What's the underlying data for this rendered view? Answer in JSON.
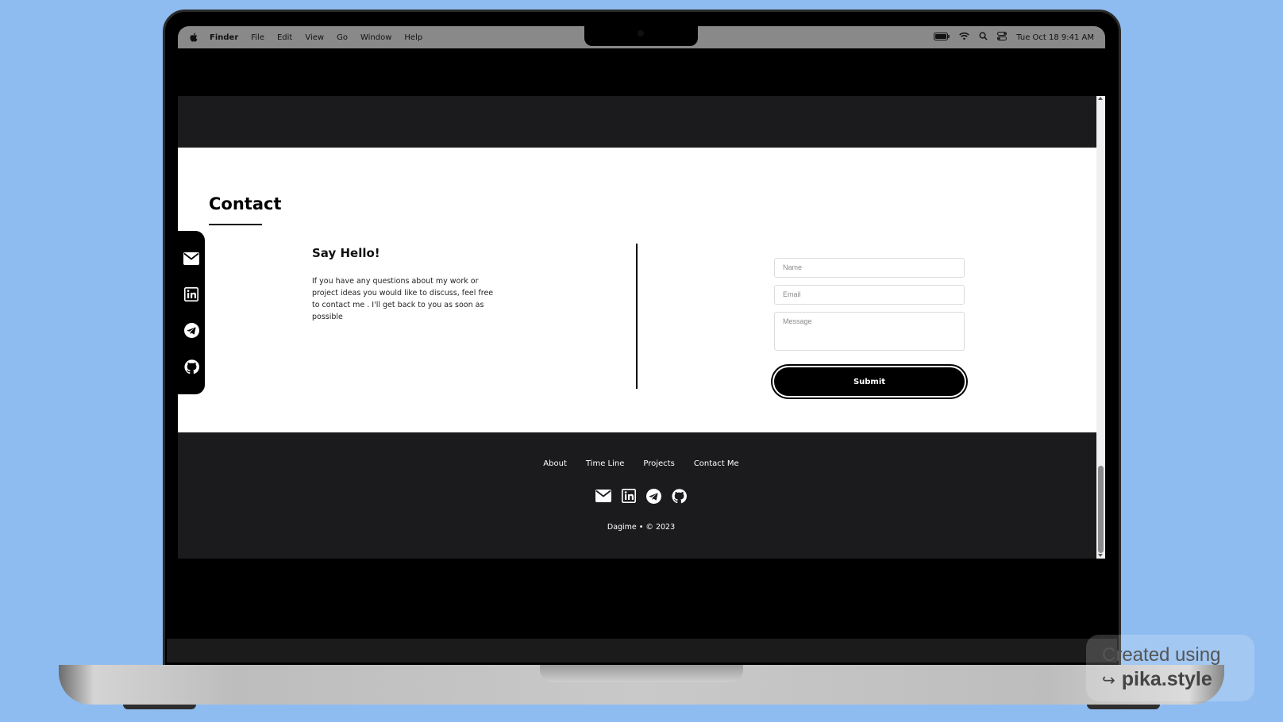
{
  "menubar": {
    "app_name": "Finder",
    "items": [
      "File",
      "Edit",
      "View",
      "Go",
      "Window",
      "Help"
    ],
    "datetime": "Tue Oct 18  9:41 AM",
    "status_icons": [
      "battery-icon",
      "wifi-icon",
      "search-icon",
      "control-center-icon"
    ]
  },
  "contact": {
    "title": "Contact",
    "say_hello": "Say Hello!",
    "description": "If you have any questions about my work or project ideas you would like to discuss, feel free to contact me . I'll get back to you as soon as possible",
    "side_icons": [
      "mail-icon",
      "linkedin-icon",
      "telegram-icon",
      "github-icon"
    ]
  },
  "form": {
    "name_placeholder": "Name",
    "email_placeholder": "Email",
    "message_placeholder": "Message",
    "submit_label": "Submit"
  },
  "footer": {
    "nav": [
      "About",
      "Time Line",
      "Projects",
      "Contact Me"
    ],
    "icons": [
      "mail-icon",
      "linkedin-icon",
      "telegram-icon",
      "github-icon"
    ],
    "copyright": "Dagime • © 2023"
  },
  "watermark": {
    "line1": "Created using",
    "line2": "pika.style"
  },
  "colors": {
    "background": "#8fbcf0",
    "dark_band": "#1b1b1d",
    "accent": "#000000"
  }
}
